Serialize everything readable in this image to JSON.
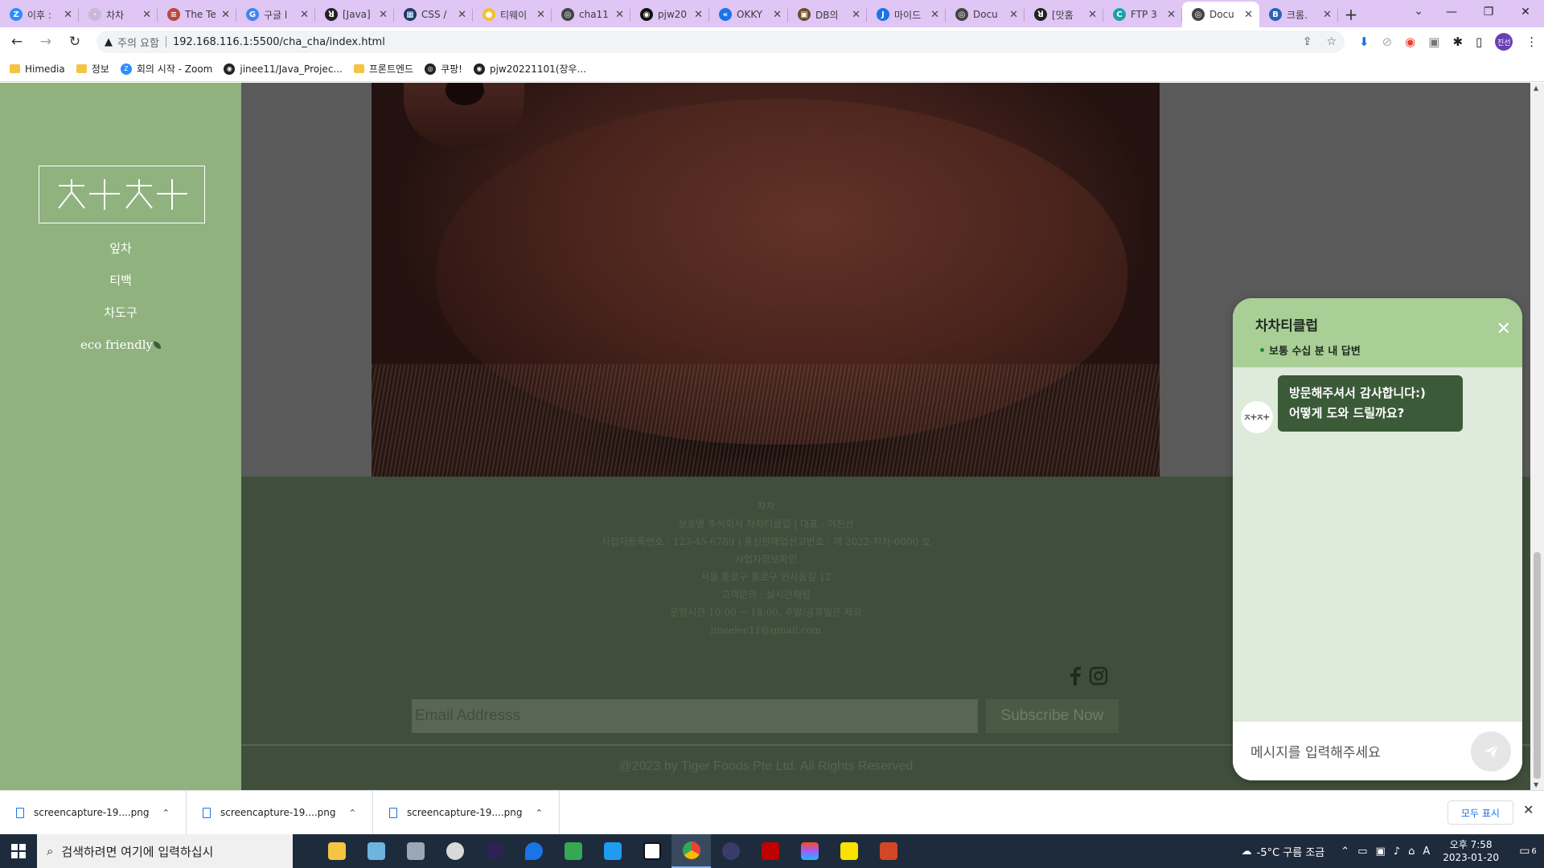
{
  "browser": {
    "tabs": [
      {
        "title": "이후 :",
        "color": "#2d8cff",
        "glyph": "Z"
      },
      {
        "title": "차차",
        "color": "#c8b9d8",
        "glyph": "·"
      },
      {
        "title": "The Te",
        "color": "#b84a3c",
        "glyph": "≡"
      },
      {
        "title": "구글 l",
        "color": "#4285f4",
        "glyph": "G"
      },
      {
        "title": "[Java]",
        "color": "#222222",
        "glyph": "ꓤ"
      },
      {
        "title": "CSS /",
        "color": "#1a3a6b",
        "glyph": "▦"
      },
      {
        "title": "티웨이",
        "color": "#f2c12e",
        "glyph": "●"
      },
      {
        "title": "cha11",
        "color": "#444444",
        "glyph": "◎"
      },
      {
        "title": "pjw20",
        "color": "#111111",
        "glyph": "◉"
      },
      {
        "title": "OKKY",
        "color": "#1a73e8",
        "glyph": "«"
      },
      {
        "title": "DB의",
        "color": "#6b4b2b",
        "glyph": "▣"
      },
      {
        "title": "마이드",
        "color": "#1a73e8",
        "glyph": "J"
      },
      {
        "title": "Docu",
        "color": "#444444",
        "glyph": "◎"
      },
      {
        "title": "[맛홈",
        "color": "#222222",
        "glyph": "ꓤ"
      },
      {
        "title": "FTP 3",
        "color": "#1aa3a3",
        "glyph": "C"
      },
      {
        "title": "Docu",
        "color": "#444444",
        "glyph": "◎",
        "active": true
      },
      {
        "title": "크롬.",
        "color": "#2962b8",
        "glyph": "B"
      }
    ],
    "address": {
      "warning": "주의 요함",
      "url": "192.168.116.1:5500/cha_cha/index.html"
    },
    "profile_initials": "진선",
    "bookmarks": [
      {
        "label": "Himedia",
        "type": "folder"
      },
      {
        "label": "정보",
        "type": "folder"
      },
      {
        "label": "회의 시작 - Zoom",
        "type": "zoom"
      },
      {
        "label": "jinee11/Java_Projec...",
        "type": "github"
      },
      {
        "label": "프론트엔드",
        "type": "folder"
      },
      {
        "label": "쿠팡!",
        "type": "globe"
      },
      {
        "label": "pjw20221101(장우...",
        "type": "github"
      }
    ]
  },
  "site": {
    "menu": [
      "잎차",
      "티백",
      "차도구",
      "eco friendly"
    ],
    "footer": {
      "lines": [
        "차차",
        "상호명 주식회사 차차티클럽 | 대표 : 이진선",
        "사업자등록번호 : 123-45-6789 | 통신판매업신고번호 : 제 2022-차차-0000 호",
        "사업자정보확인",
        "서울 종로구 종로구 인사동길 12",
        "고객문의 : 실시간채팅",
        "운영시간 10:00 ~ 18:00, 주말/공휴일은 제외",
        "jineelee11@gmail.com"
      ],
      "email_placeholder": "Email Addresss",
      "subscribe_label": "Subscribe Now",
      "copyright": "@2023 by Tiger Foods Pte Ltd. All Rights Reserved"
    }
  },
  "chat": {
    "title": "차차티클럽",
    "status": "보통 수십 분 내 답변",
    "message_line1": "방문해주셔서 감사합니다:)",
    "message_line2": "어떻게 도와 드릴까요?",
    "input_placeholder": "메시지를 입력해주세요"
  },
  "downloads": {
    "items": [
      "screencapture-19....png",
      "screencapture-19....png",
      "screencapture-19....png"
    ],
    "show_all": "모두 표시"
  },
  "taskbar": {
    "search_placeholder": "검색하려면 여기에 입력하십시",
    "weather": "-5°C 구름 조금",
    "ime": "A",
    "time": "오후 7:58",
    "date": "2023-01-20",
    "notification_count": "6"
  }
}
